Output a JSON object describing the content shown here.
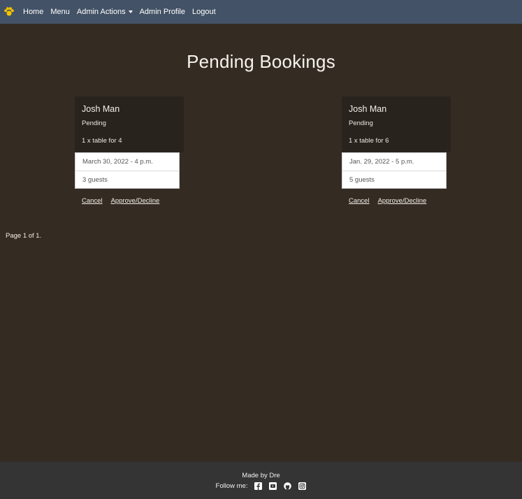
{
  "nav": {
    "logo_icon": "paw-icon",
    "items": [
      "Home",
      "Menu",
      "Admin Actions",
      "Admin Profile",
      "Logout"
    ]
  },
  "page_title": "Pending Bookings",
  "bookings": [
    {
      "name": "Josh Man",
      "status": "Pending",
      "table": "1 x table for 4",
      "datetime": "March 30, 2022 - 4 p.m.",
      "guests": "3 guests",
      "cancel": "Cancel",
      "approve": "Approve/Decline"
    },
    {
      "name": "Josh Man",
      "status": "Pending",
      "table": "1 x table for 6",
      "datetime": "Jan. 29, 2022 - 5 p.m.",
      "guests": "5 guests",
      "cancel": "Cancel",
      "approve": "Approve/Decline"
    }
  ],
  "pagination": "Page 1 of 1.",
  "footer": {
    "made_by": "Made by Dre",
    "follow_label": "Follow me:",
    "social_icons": [
      "facebook-icon",
      "youtube-icon",
      "github-icon",
      "instagram-icon"
    ]
  },
  "colors": {
    "navbar": "#435266",
    "background": "#342c23",
    "card_header": "#29231d",
    "footer": "#343434",
    "logo": "#f5c400"
  }
}
